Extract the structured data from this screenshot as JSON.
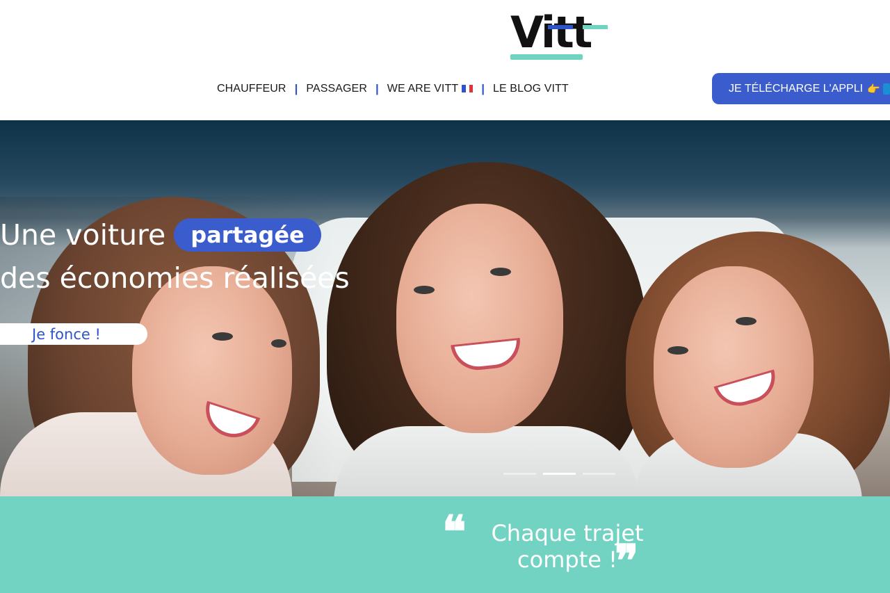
{
  "brand": {
    "logo_text": "Vitt",
    "accent": "#6fd3c2",
    "primary": "#3a5ccc"
  },
  "nav": {
    "items": [
      {
        "label": "CHAUFFEUR"
      },
      {
        "label": "PASSAGER"
      },
      {
        "label": "WE ARE VITT"
      },
      {
        "label": "LE BLOG VITT"
      }
    ],
    "separator": "|"
  },
  "header": {
    "download_label": "JE TÉLÉCHARGE L'APPLI",
    "download_emoji": "👉"
  },
  "hero": {
    "title_line1": "Une voiture",
    "highlight": "partagée",
    "title_line2": "des économies réalisées",
    "cta_label": "Je fonce !",
    "slides_count": 3,
    "active_slide": 2
  },
  "quote": {
    "text": "Chaque trajet compte !",
    "open_mark": "❝",
    "close_mark": "❞",
    "band_color": "#72d3c3"
  }
}
